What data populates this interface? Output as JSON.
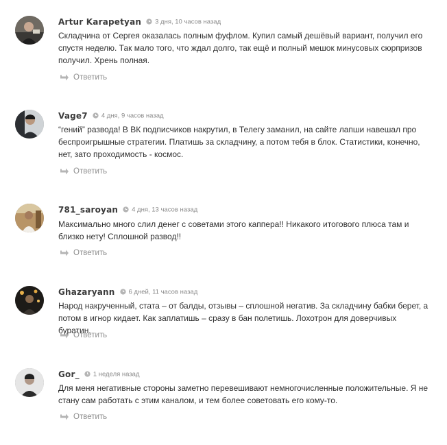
{
  "comments": [
    {
      "author": "Artur Karapetyan",
      "date": "3 дня, 10 часов назад",
      "text": "Складчина от Сергея оказалась полным фуфлом. Купил самый дешёвый вариант, получил его спустя неделю. Так мало того, что ждал долго, так ещё и полный мешок минусовых сюрпризов получил. Хрень полная.",
      "reply_label": "Ответить"
    },
    {
      "author": "Vage7",
      "date": "4 дня, 9 часов назад",
      "text": "“гений” развода! В ВК подписчиков накрутил, в Телегу заманил, на сайте лапши навешал про беспроигрышные стратегии. Платишь за складчину, а потом тебя в блок. Статистики, конечно, нет, зато проходимость - космос.",
      "reply_label": "Ответить"
    },
    {
      "author": "781_saroyan",
      "date": "4 дня, 13 часов назад",
      "text": "Максимально много слил денег с советами этого каппера!! Никакого итогового плюса там и близко нету! Сплошной развод!!",
      "reply_label": "Ответить"
    },
    {
      "author": "Ghazaryann",
      "date": "6 дней, 11 часов назад",
      "text": "Народ накрученный, стата – от балды, отзывы – сплошной негатив. За складчину бабки берет, а потом в игнор кидает. Как заплатишь – сразу в бан полетишь. Лохотрон для доверчивых буратин.",
      "reply_label": "Ответить"
    },
    {
      "author": "Gor_",
      "date": "1 неделя назад",
      "text": "Для меня негативные стороны заметно перевешивают немногочисленные положительные. Я не стану сам работать с этим каналом, и тем более советовать его кому-то.",
      "reply_label": "Ответить"
    }
  ],
  "icons": {
    "clock": "clock-icon",
    "reply": "reply-arrow-icon"
  },
  "colors": {
    "author": "#3c3c3c",
    "meta": "#8a8a8a",
    "text": "#2f2f2f",
    "icon": "#b5b5b5"
  }
}
